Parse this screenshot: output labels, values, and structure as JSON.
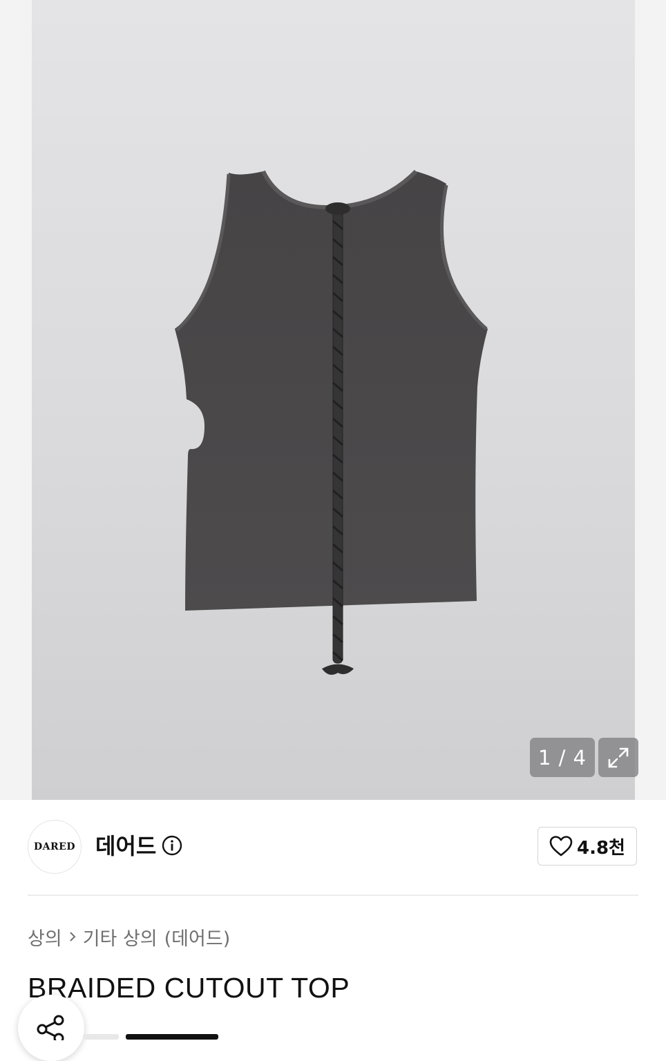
{
  "gallery": {
    "counter": "1 / 4",
    "icons": {
      "expand": "expand-arrows-icon"
    },
    "image_alt": "Dark gray sleeveless top with braided back strap"
  },
  "brand": {
    "logo_text": "DARED",
    "name": "데어드",
    "info_icon": "info-icon"
  },
  "likes": {
    "icon": "heart-outline-icon",
    "count": "4.8천"
  },
  "breadcrumb": {
    "items": [
      "상의",
      "기타 상의",
      "(데어드)"
    ]
  },
  "product": {
    "title": "BRAIDED CUTOUT TOP"
  },
  "share": {
    "icon": "share-icon"
  },
  "colors": {
    "background": "#ffffff",
    "gallery_bg": "#dcdcde",
    "garment": "#4a4849",
    "text_primary": "#111111",
    "text_secondary": "#6f6f6f",
    "overlay": "#87878a"
  }
}
